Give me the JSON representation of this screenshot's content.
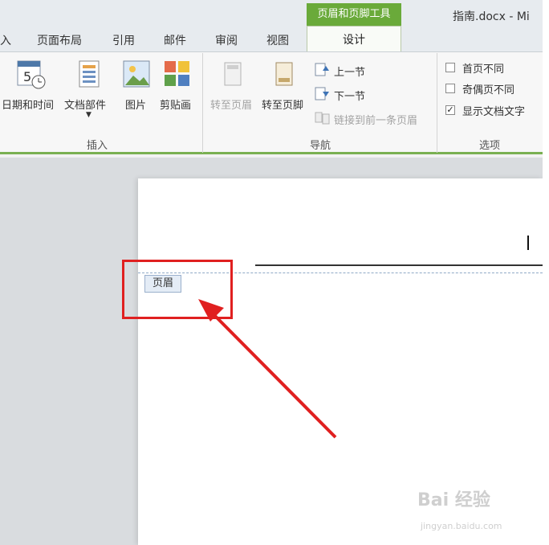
{
  "tabs": [
    "入",
    "页面布局",
    "引用",
    "邮件",
    "审阅",
    "视图"
  ],
  "context_tab_group": "页眉和页脚工具",
  "active_tab": "设计",
  "document_title": "指南.docx - Mi",
  "groups": {
    "insert": {
      "label": "插入",
      "buttons": [
        {
          "label": "日期和时间",
          "icon": "calendar-clock-icon"
        },
        {
          "label": "文档部件",
          "icon": "document-parts-icon"
        },
        {
          "label": "图片",
          "icon": "picture-icon"
        },
        {
          "label": "剪贴画",
          "icon": "clipart-icon"
        }
      ]
    },
    "navigation": {
      "label": "导航",
      "goto_header": "转至页眉",
      "goto_footer": "转至页脚",
      "previous_section": "上一节",
      "next_section": "下一节",
      "link_to_previous": "链接到前一条页眉"
    },
    "options": {
      "label": "选项",
      "checkboxes": [
        {
          "label": "首页不同",
          "checked": false
        },
        {
          "label": "奇偶页不同",
          "checked": false
        },
        {
          "label": "显示文档文字",
          "checked": true
        }
      ]
    }
  },
  "document": {
    "header_tag": "页眉"
  },
  "watermark": {
    "main": "Bai 经验",
    "sub": "jingyan.baidu.com"
  },
  "colors": {
    "context_green": "#6aaa3a",
    "highlight_red": "#e02020",
    "header_dash": "#8fa9c6"
  }
}
